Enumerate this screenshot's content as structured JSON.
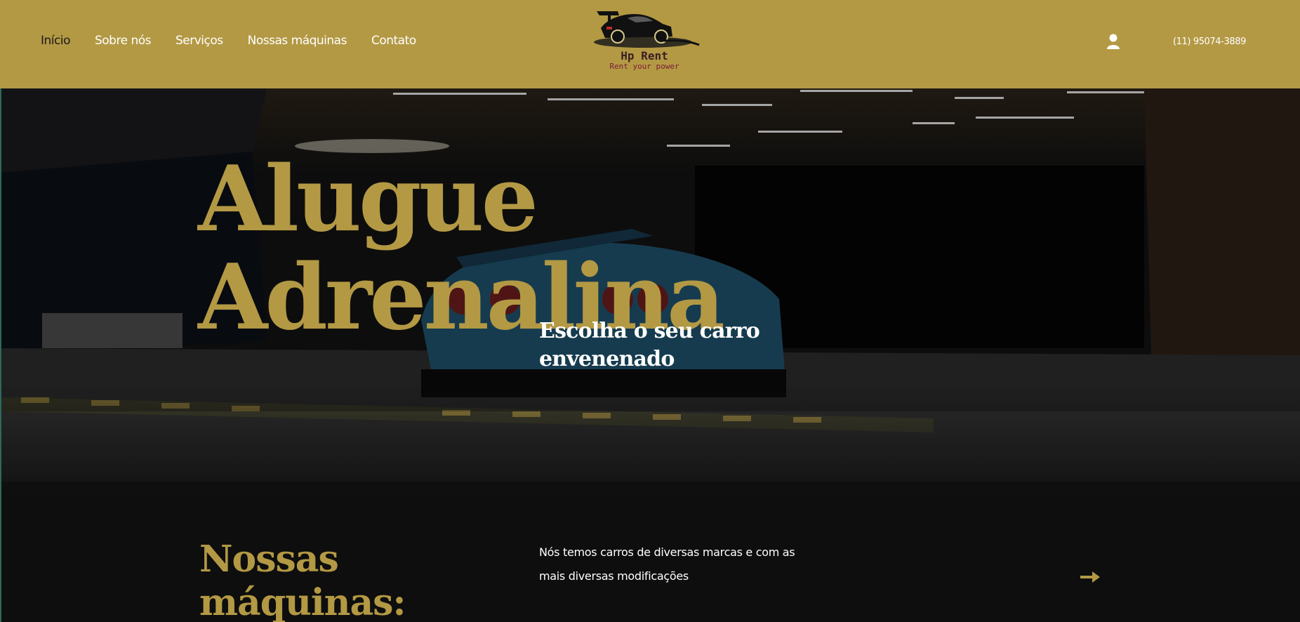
{
  "nav": {
    "items": [
      {
        "label": "Início",
        "active": true
      },
      {
        "label": "Sobre nós",
        "active": false
      },
      {
        "label": "Serviços",
        "active": false
      },
      {
        "label": "Nossas máquinas",
        "active": false
      },
      {
        "label": "Contato",
        "active": false
      }
    ]
  },
  "logo": {
    "name": "Hp Rent",
    "tagline": "Rent your power",
    "icon": "sports-car-logo"
  },
  "header": {
    "phone": "(11) 95074-3889",
    "user_icon": "user-icon"
  },
  "hero": {
    "title_line1": "Alugue",
    "title_line2": "Adrenalina",
    "subtitle": "Escolha o seu carro envenenado"
  },
  "section": {
    "title_line1": "Nossas",
    "title_line2": "máquinas:",
    "text": "Nós temos carros de diversas marcas  e com as mais diversas modificações",
    "arrow_icon": "arrow-right-icon"
  },
  "colors": {
    "brand_gold": "#b39944",
    "dark_bg": "#0e0e0e",
    "text_white": "#ffffff"
  }
}
